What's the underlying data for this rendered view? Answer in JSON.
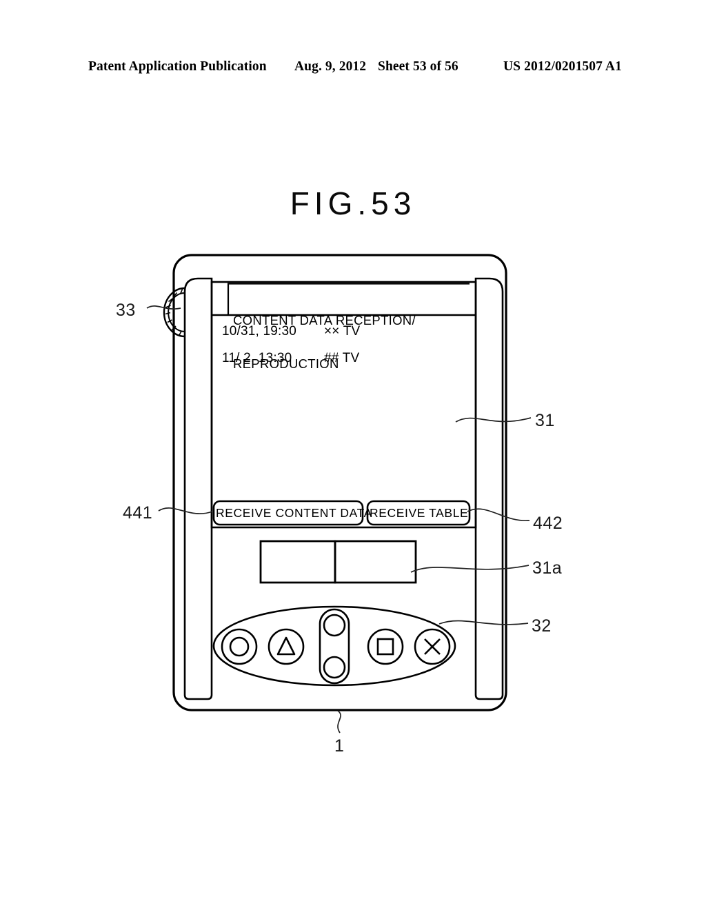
{
  "header": {
    "publication": "Patent Application Publication",
    "date": "Aug. 9, 2012",
    "sheet": "Sheet 53 of 56",
    "number": "US 2012/0201507 A1"
  },
  "figure": {
    "title": "FIG.53"
  },
  "device": {
    "screen": {
      "title_line_1": "CONTENT DATA RECEPTION/",
      "title_line_2": "REPRODUCTION",
      "list": [
        {
          "time": "10/31, 19:30",
          "channel": "×× TV"
        },
        {
          "time": "11/ 2, 13:30",
          "channel": "## TV"
        }
      ],
      "buttons": [
        {
          "label": "RECEIVE CONTENT DATA"
        },
        {
          "label": "RECEIVE TABLE"
        }
      ]
    },
    "controls": {
      "icons": [
        "circle-button",
        "triangle-button",
        "dpad-up-button",
        "dpad-down-button",
        "square-button",
        "cross-button"
      ]
    }
  },
  "reference_numerals": {
    "jog_dial": "33",
    "receive_content_data_button": "441",
    "display_panel": "31",
    "receive_table_button": "442",
    "sub_display": "31a",
    "control_pad": "32",
    "device_body": "1"
  },
  "colors": {
    "line": "#000000",
    "background": "#ffffff"
  }
}
